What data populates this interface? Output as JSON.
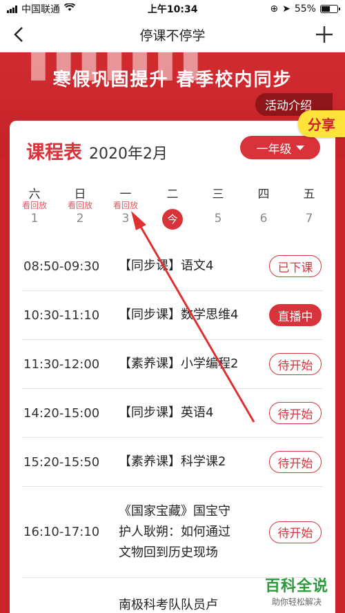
{
  "status_bar": {
    "carrier": "中国联通",
    "time": "上午10:34",
    "battery": "55%",
    "battery_level": 0.55
  },
  "nav": {
    "title": "停课不停学"
  },
  "banner": {
    "subtitle": "寒假巩固提升 春季校内同步",
    "activity_label": "活动介绍",
    "share_label": "分享"
  },
  "schedule": {
    "title": "课程表",
    "month": "2020年2月",
    "grade": "一年级",
    "days": [
      {
        "name": "六",
        "num": "1",
        "replay": "看回放"
      },
      {
        "name": "日",
        "num": "2",
        "replay": "看回放"
      },
      {
        "name": "一",
        "num": "3",
        "replay": "看回放"
      },
      {
        "name": "二",
        "num": "今",
        "today": true
      },
      {
        "name": "三",
        "num": "5"
      },
      {
        "name": "四",
        "num": "6"
      },
      {
        "name": "五",
        "num": "7"
      }
    ],
    "courses": [
      {
        "time": "08:50-09:30",
        "lines": [
          "【同步课】语文4"
        ],
        "status": "已下课",
        "style": "outline"
      },
      {
        "time": "10:30-11:10",
        "lines": [
          "【同步课】数学思维4"
        ],
        "status": "直播中",
        "style": "filled"
      },
      {
        "time": "11:30-12:00",
        "lines": [
          "【素养课】小学编程2"
        ],
        "status": "待开始",
        "style": "outline"
      },
      {
        "time": "14:20-15:00",
        "lines": [
          "【同步课】英语4"
        ],
        "status": "待开始",
        "style": "outline"
      },
      {
        "time": "15:20-15:50",
        "lines": [
          "【素养课】科学课2"
        ],
        "status": "待开始",
        "style": "outline"
      },
      {
        "time": "16:10-17:10",
        "lines": [
          "《国家宝藏》国宝守",
          "护人耿朔：如何通过",
          "文物回到历史现场"
        ],
        "status": "待开始",
        "style": "outline"
      },
      {
        "time": "",
        "lines": [
          "南极科考队队员卢"
        ],
        "status": "",
        "style": "outline"
      }
    ]
  },
  "watermark": {
    "main": "百科全说",
    "sub": "助你轻松解决"
  },
  "colors": {
    "accent": "#d8323a",
    "banner": "#c8242a",
    "share": "#ffe23a"
  }
}
